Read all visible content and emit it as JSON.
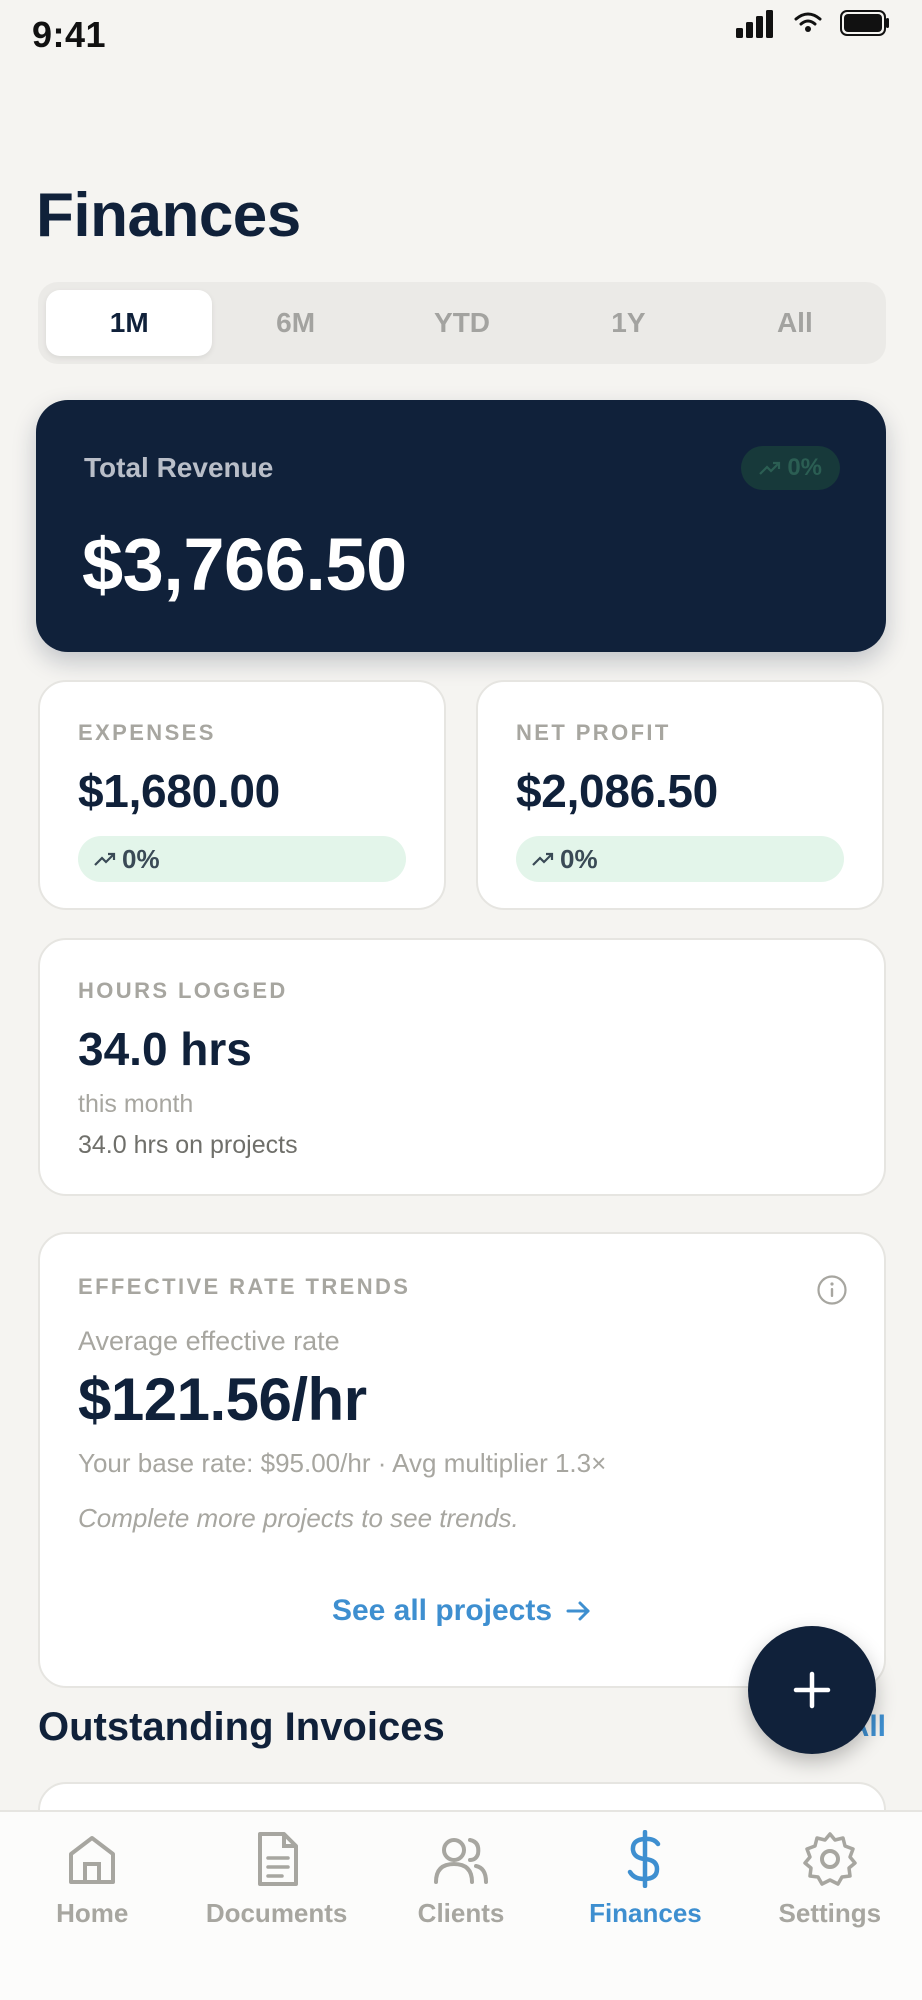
{
  "status": {
    "time": "9:41"
  },
  "page": {
    "title": "Finances"
  },
  "periods": [
    {
      "label": "1M",
      "active": true
    },
    {
      "label": "6M",
      "active": false
    },
    {
      "label": "YTD",
      "active": false
    },
    {
      "label": "1Y",
      "active": false
    },
    {
      "label": "All",
      "active": false
    }
  ],
  "revenue": {
    "label": "Total Revenue",
    "value": "$3,766.50",
    "change": "0%"
  },
  "expenses": {
    "label": "EXPENSES",
    "value": "$1,680.00",
    "change": "0%"
  },
  "profit": {
    "label": "NET PROFIT",
    "value": "$2,086.50",
    "change": "0%"
  },
  "hours": {
    "label": "HOURS LOGGED",
    "value": "34.0 hrs",
    "period": "this month",
    "detail": "34.0 hrs on projects"
  },
  "rate": {
    "label": "EFFECTIVE RATE TRENDS",
    "sub": "Average effective rate",
    "value": "$121.56/hr",
    "base": "Your base rate: $95.00/hr · Avg multiplier 1.3×",
    "note": "Complete more projects to see trends.",
    "link": "See all projects"
  },
  "invoices": {
    "title": "Outstanding Invoices",
    "see_all": "All"
  },
  "tabs": [
    {
      "label": "Home",
      "icon": "home-icon",
      "active": false
    },
    {
      "label": "Documents",
      "icon": "document-icon",
      "active": false
    },
    {
      "label": "Clients",
      "icon": "clients-icon",
      "active": false
    },
    {
      "label": "Finances",
      "icon": "dollar-icon",
      "active": true
    },
    {
      "label": "Settings",
      "icon": "gear-icon",
      "active": false
    }
  ],
  "colors": {
    "navy": "#10213a",
    "accent": "#3e8fd0",
    "background": "#f5f4f1",
    "positive_pill": "#e3f5ea"
  }
}
